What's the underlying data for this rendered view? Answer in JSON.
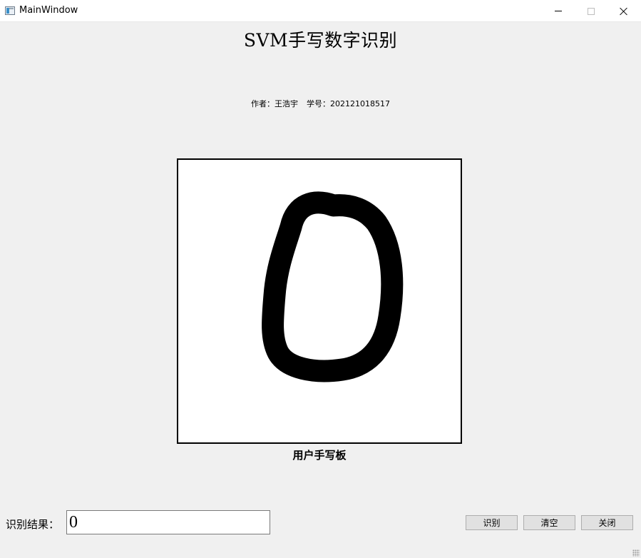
{
  "window": {
    "title": "MainWindow",
    "icon": "app-window-icon",
    "controls": [
      "minimize-icon",
      "maximize-icon",
      "close-icon"
    ]
  },
  "header": {
    "title": "SVM手写数字识别",
    "author": "作者：王浩宇",
    "student_id": "学号：202121018517"
  },
  "canvas": {
    "label": "用户手写板",
    "drawn_digit": "0",
    "background": "#ffffff",
    "stroke_color": "#000000"
  },
  "result": {
    "label": "识别结果：",
    "value": "0"
  },
  "buttons": {
    "recognize": "识别",
    "clear": "清空",
    "close": "关闭"
  }
}
